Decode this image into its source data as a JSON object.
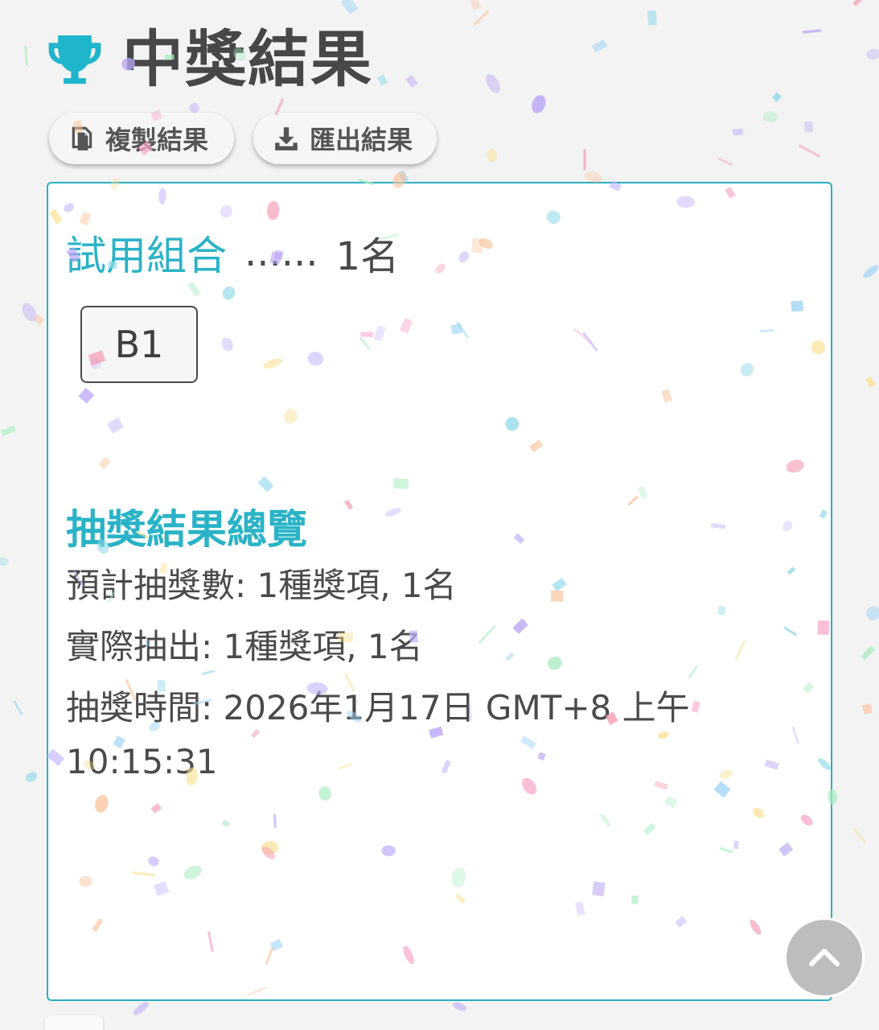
{
  "header": {
    "title": "中獎結果",
    "icon": "trophy-icon",
    "icon_color": "#1fb5cc"
  },
  "actions": {
    "copy_label": "複製結果",
    "copy_icon": "copy-icon",
    "export_label": "匯出結果",
    "export_icon": "download-icon"
  },
  "result": {
    "prize_name": "試用組合",
    "dots": "......",
    "prize_count": "1名",
    "winners": [
      "B1"
    ]
  },
  "summary": {
    "title": "抽獎結果總覽",
    "expected": "預計抽獎數: 1種獎項, 1名",
    "actual": "實際抽出: 1種獎項, 1名",
    "time": "抽獎時間: 2026年1月17日 GMT+8 上午",
    "time_cont": "10:15:31"
  },
  "scroll_top": {
    "icon": "chevron-up-icon"
  },
  "colors": {
    "accent": "#2ab3c6",
    "border": "#2bb0c0",
    "text": "#4a4a4a"
  }
}
